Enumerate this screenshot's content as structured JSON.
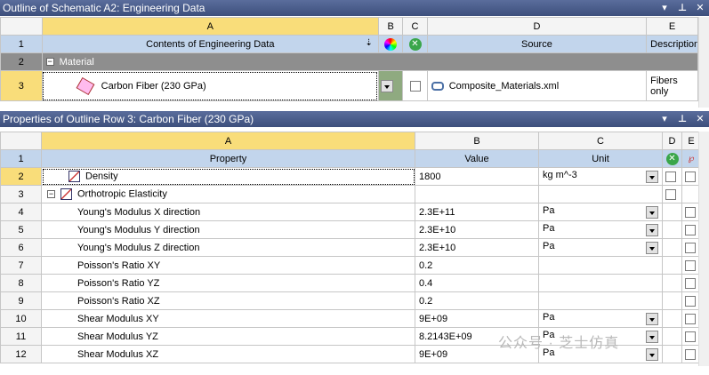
{
  "top_panel": {
    "title": "Outline of Schematic A2: Engineering Data",
    "col_letters": [
      "A",
      "B",
      "C",
      "D",
      "E"
    ],
    "header": {
      "contents": "Contents of Engineering Data",
      "source": "Source",
      "description": "Description"
    },
    "rows": [
      {
        "num": "1"
      },
      {
        "num": "2",
        "label": "Material"
      },
      {
        "num": "3",
        "name": "Carbon Fiber (230 GPa)",
        "source": "Composite_Materials.xml",
        "description": "Fibers only"
      }
    ]
  },
  "props_panel": {
    "title": "Properties of Outline Row 3: Carbon Fiber (230 GPa)",
    "col_letters": [
      "A",
      "B",
      "C",
      "D",
      "E"
    ],
    "header": {
      "property": "Property",
      "value": "Value",
      "unit": "Unit"
    },
    "rows": [
      {
        "num": "2",
        "property": "Density",
        "value": "1800",
        "unit": "kg m^-3"
      },
      {
        "num": "3",
        "property": "Orthotropic Elasticity",
        "value": "",
        "unit": ""
      },
      {
        "num": "4",
        "property": "Young's Modulus X direction",
        "value": "2.3E+11",
        "unit": "Pa"
      },
      {
        "num": "5",
        "property": "Young's Modulus Y direction",
        "value": "2.3E+10",
        "unit": "Pa"
      },
      {
        "num": "6",
        "property": "Young's Modulus Z direction",
        "value": "2.3E+10",
        "unit": "Pa"
      },
      {
        "num": "7",
        "property": "Poisson's Ratio XY",
        "value": "0.2",
        "unit": ""
      },
      {
        "num": "8",
        "property": "Poisson's Ratio YZ",
        "value": "0.4",
        "unit": ""
      },
      {
        "num": "9",
        "property": "Poisson's Ratio XZ",
        "value": "0.2",
        "unit": ""
      },
      {
        "num": "10",
        "property": "Shear Modulus XY",
        "value": "9E+09",
        "unit": "Pa"
      },
      {
        "num": "11",
        "property": "Shear Modulus YZ",
        "value": "8.2143E+09",
        "unit": "Pa"
      },
      {
        "num": "12",
        "property": "Shear Modulus XZ",
        "value": "9E+09",
        "unit": "Pa"
      }
    ],
    "header_row_num": "1"
  },
  "watermark": "公众号 · 芝士仿真"
}
